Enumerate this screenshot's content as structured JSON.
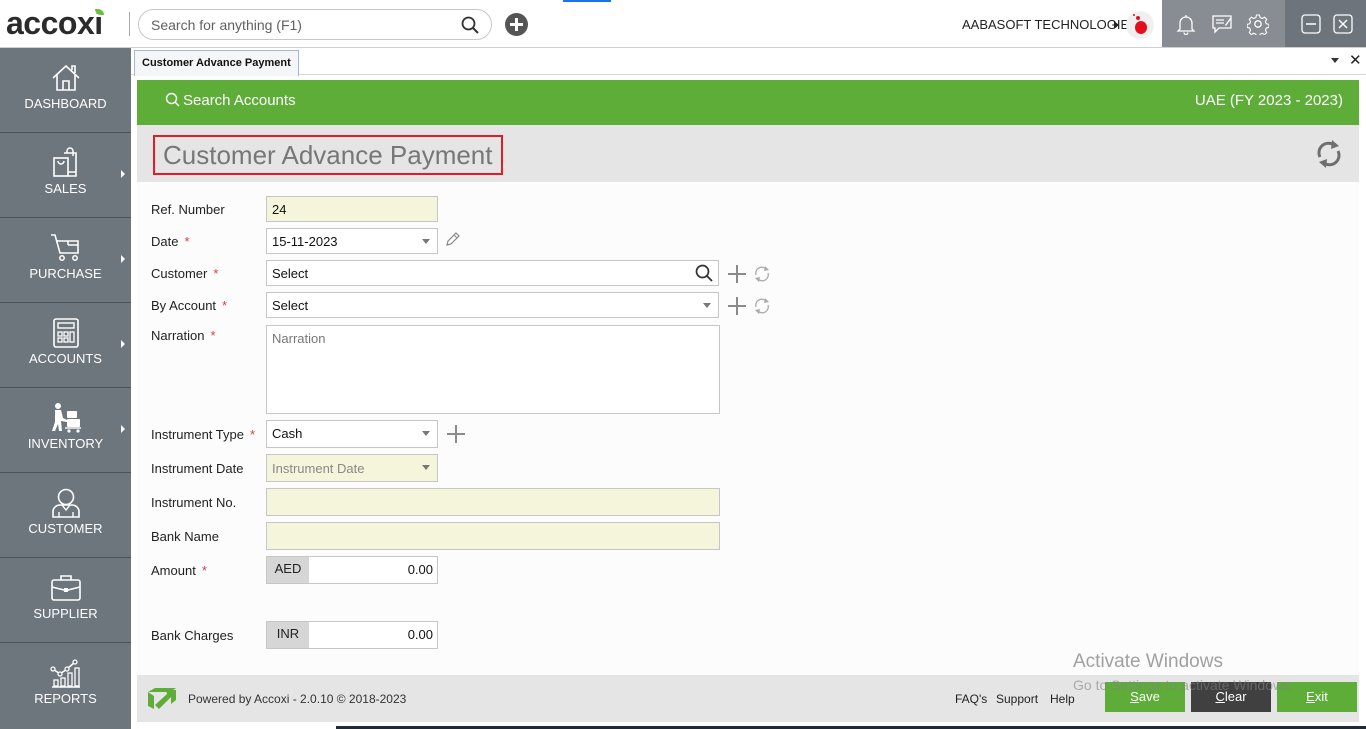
{
  "app": {
    "logo_text": "accoxi",
    "search_placeholder": "Search for anything (F1)",
    "company_name": "AABASOFT TECHNOLOGIES",
    "icons": [
      "search-icon",
      "add-circle-icon",
      "bell-icon",
      "message-icon",
      "gear-icon",
      "minimize-icon",
      "close-icon"
    ]
  },
  "sidebar": {
    "items": [
      {
        "label": "DASHBOARD",
        "icon": "home-icon",
        "has_submenu": false
      },
      {
        "label": "SALES",
        "icon": "shopping-bag-icon",
        "has_submenu": true
      },
      {
        "label": "PURCHASE",
        "icon": "cart-icon",
        "has_submenu": true
      },
      {
        "label": "ACCOUNTS",
        "icon": "calculator-icon",
        "has_submenu": true
      },
      {
        "label": "INVENTORY",
        "icon": "trolley-icon",
        "has_submenu": true
      },
      {
        "label": "CUSTOMER",
        "icon": "user-icon",
        "has_submenu": false
      },
      {
        "label": "SUPPLIER",
        "icon": "briefcase-icon",
        "has_submenu": false
      },
      {
        "label": "REPORTS",
        "icon": "chart-icon",
        "has_submenu": false
      }
    ]
  },
  "tabs": [
    {
      "label": "Customer Advance Payment",
      "active": true
    }
  ],
  "header": {
    "search_accounts": "Search Accounts",
    "fiscal_year": "UAE (FY 2023 - 2023)",
    "page_title": "Customer Advance Payment"
  },
  "form": {
    "ref_number": {
      "label": "Ref. Number",
      "value": "24"
    },
    "date": {
      "label": "Date",
      "required": true,
      "value": "15-11-2023"
    },
    "customer": {
      "label": "Customer",
      "required": true,
      "value": "Select"
    },
    "by_account": {
      "label": "By Account",
      "required": true,
      "value": "Select"
    },
    "narration": {
      "label": "Narration",
      "required": true,
      "placeholder": "Narration",
      "value": ""
    },
    "instrument_type": {
      "label": "Instrument Type",
      "required": true,
      "value": "Cash"
    },
    "instrument_date": {
      "label": "Instrument Date",
      "placeholder": "Instrument Date"
    },
    "instrument_no": {
      "label": "Instrument No.",
      "value": ""
    },
    "bank_name": {
      "label": "Bank Name",
      "value": ""
    },
    "amount": {
      "label": "Amount",
      "required": true,
      "currency": "AED",
      "value": "0.00"
    },
    "bank_charges": {
      "label": "Bank Charges",
      "currency": "INR",
      "value": "0.00"
    },
    "required_mark": "*"
  },
  "footer": {
    "powered_by": "Powered by Accoxi - 2.0.10 © 2018-2023",
    "links": [
      "FAQ's",
      "Support",
      "Help"
    ],
    "buttons": {
      "save": {
        "hotkey": "S",
        "rest": "ave"
      },
      "clear": {
        "hotkey": "C",
        "rest": "lear"
      },
      "exit": {
        "hotkey": "E",
        "rest": "xit"
      }
    }
  },
  "watermark": {
    "line1": "Activate Windows",
    "line2": "Go to Settings to activate Windows."
  },
  "colors": {
    "brand_green": "#5ead39",
    "sidebar": "#6d757d",
    "highlight_red": "#e21c24",
    "readonly_yellow": "#f5f5dc"
  }
}
